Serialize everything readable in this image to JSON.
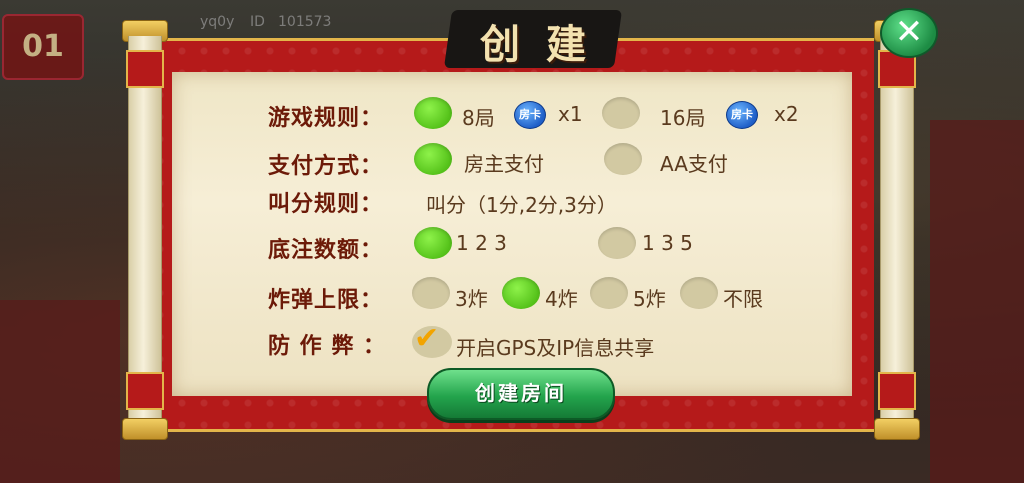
{
  "hud": {
    "logo_text": "01",
    "player_name": "yq0y",
    "id_label": "ID",
    "id_value": "101573"
  },
  "dialog": {
    "title": "创建",
    "close_icon": "close-x-icon"
  },
  "rules": {
    "game_rules": {
      "label": "游戏规则：",
      "options": [
        {
          "text": "8局",
          "card": "房卡",
          "mult": "x1",
          "selected": true
        },
        {
          "text": "16局",
          "card": "房卡",
          "mult": "x2",
          "selected": false
        }
      ]
    },
    "payment": {
      "label": "支付方式：",
      "options": [
        {
          "text": "房主支付",
          "selected": true
        },
        {
          "text": "AA支付",
          "selected": false
        }
      ]
    },
    "scoring": {
      "label": "叫分规则：",
      "value": "叫分（1分,2分,3分）"
    },
    "base_bet": {
      "label": "底注数额：",
      "options": [
        {
          "text": "1 2 3",
          "selected": true
        },
        {
          "text": "1 3 5",
          "selected": false
        }
      ]
    },
    "bomb_limit": {
      "label": "炸弹上限：",
      "options": [
        {
          "text": "3炸",
          "selected": false
        },
        {
          "text": "4炸",
          "selected": true
        },
        {
          "text": "5炸",
          "selected": false
        },
        {
          "text": "不限",
          "selected": false
        }
      ]
    },
    "anti_cheat": {
      "label": "防 作 弊 ：",
      "option": "开启GPS及IP信息共享",
      "checked": true
    }
  },
  "actions": {
    "create_room": "创建房间"
  },
  "colors": {
    "selected": "#6fd62c",
    "unselected": "#d2c9a2",
    "label": "#6c1a08",
    "panel_red": "#b51a1a",
    "button_green": "#23a44c"
  }
}
